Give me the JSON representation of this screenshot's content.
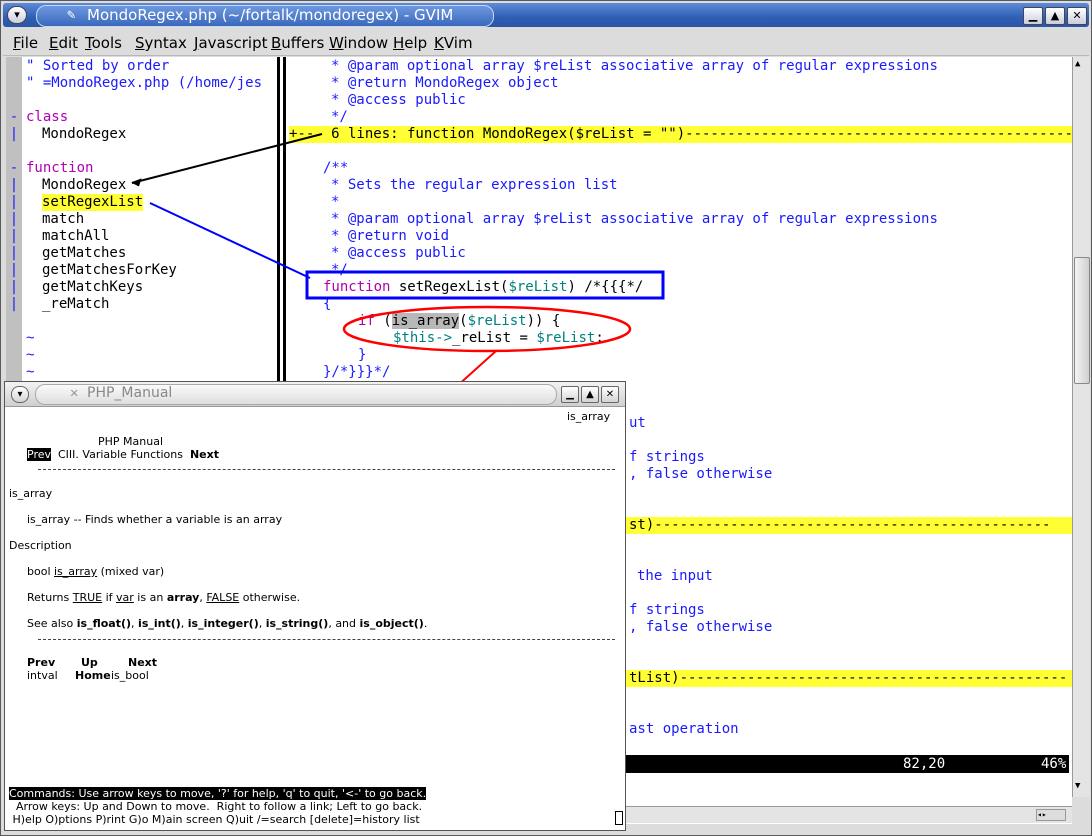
{
  "window": {
    "title": "MondoRegex.php (~/fortalk/mondoregex) - GVIM",
    "buttons": {
      "minimize": "▁",
      "maximize": "▲",
      "close": "✕"
    }
  },
  "menu": [
    "File",
    "Edit",
    "Tools",
    "Syntax",
    "Javascript",
    "Buffers",
    "Window",
    "Help",
    "KVim"
  ],
  "taglist": {
    "header": [
      "\" Sorted by order",
      "\" =MondoRegex.php (/home/jes"
    ],
    "class_label": "class",
    "class_items": [
      "MondoRegex"
    ],
    "function_label": "function",
    "function_items": [
      "MondoRegex",
      "setRegexList",
      "match",
      "matchAll",
      "getMatches",
      "getMatchesForKey",
      "getMatchKeys",
      "_reMatch"
    ],
    "tildes": [
      "~",
      "~",
      "~"
    ]
  },
  "code": {
    "top_comment": [
      "* @param optional array $reList associative array of regular expressions",
      "* @return MondoRegex object",
      "* @access public",
      "*/"
    ],
    "fold1": "+--  6 lines: function MondoRegex($reList = \"\")-----------------------------------------------------",
    "doc_open": "/**",
    "doc_lines": [
      "* Sets the regular expression list",
      "*",
      "* @param optional array $reList associative array of regular expressions",
      "* @return void",
      "* @access public",
      "*/"
    ],
    "func_kw": "function",
    "func_name": " setRegexList(",
    "func_var": "$reList",
    "func_tail": ") /*{{{*/",
    "brace_open": "{",
    "if_kw": "if",
    "if_open": " (",
    "is_array": "is_array",
    "if_paren": "(",
    "if_var": "$reList",
    "if_close": ")) {",
    "this_var": "$this->",
    "assign_mid": "_reList = ",
    "assign_var": "$reList",
    "assign_end": ";",
    "brace_close": "}",
    "fold_close": "}/*}}}*/",
    "partial": [
      "ut",
      "f strings",
      ", false otherwise",
      "st)-----------------------------------------------",
      "the input",
      "f strings",
      ", false otherwise",
      "tList)----------------------------------------------",
      "ast operation"
    ],
    "status_pos": "82,20",
    "status_pct": "46%"
  },
  "manual": {
    "title": "PHP_Manual",
    "top_right": "is_array",
    "header": "PHP Manual",
    "nav_prev": "Prev",
    "nav_section": "CIII. Variable Functions",
    "nav_next": "Next",
    "func_heading": "is_array",
    "desc_line": "is_array -- Finds whether a variable is an array",
    "description_label": "Description",
    "sig_type": "bool ",
    "sig_name": "is_array",
    "sig_args": " (mixed var)",
    "ret_1": "Returns ",
    "ret_true": "TRUE",
    "ret_2": " if ",
    "ret_var": "var",
    "ret_3": " is an ",
    "ret_array": "array",
    "ret_4": ", ",
    "ret_false": "FALSE",
    "ret_5": " otherwise.",
    "see_1": "See also ",
    "see_float": "is_float()",
    "see_int": "is_int()",
    "see_integer": "is_integer()",
    "see_string": "is_string()",
    "see_and": ", and ",
    "see_object": "is_object()",
    "foot_prev": "Prev",
    "foot_up": "Up",
    "foot_next": "Next",
    "foot_intval": "intval",
    "foot_home": "Home",
    "foot_isbool": "is_bool",
    "cmd1": "Commands: Use arrow keys to move, '?' for help, 'q' to quit, '<-' to go back.",
    "cmd2": "  Arrow keys: Up and Down to move.  Right to follow a link; Left to go back.",
    "cmd3": " H)elp O)ptions P)rint G)o M)ain screen Q)uit /=search [delete]=history list"
  },
  "colors": {
    "fold": "#ffff33",
    "comment": "#1a1aff",
    "keyword": "#b000b0",
    "variable": "#008080",
    "annot_black": "#000000",
    "annot_blue": "#0000ff",
    "annot_red": "#ff0000"
  }
}
